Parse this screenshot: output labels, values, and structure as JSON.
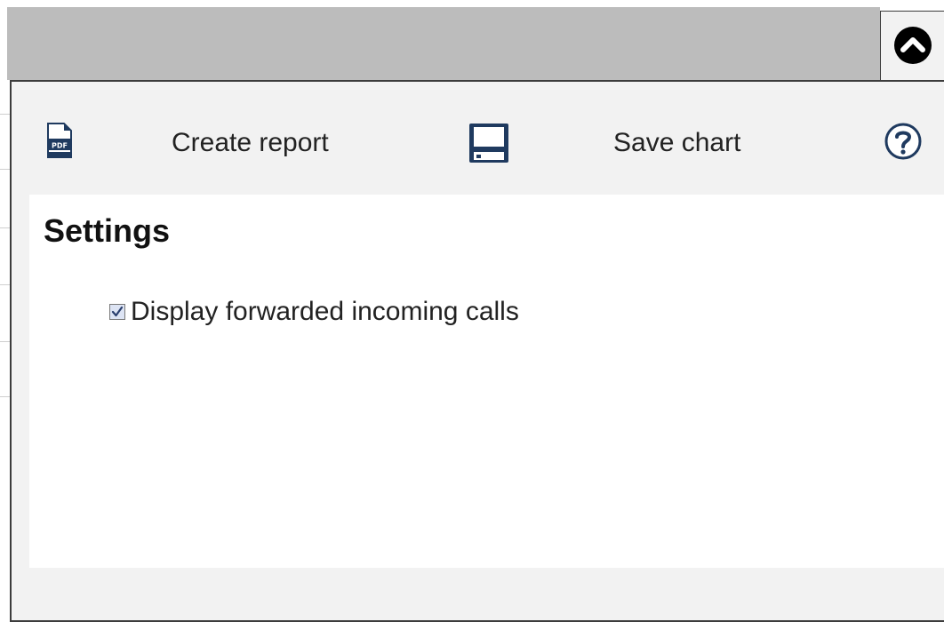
{
  "toolbar": {
    "create_report_label": "Create report",
    "save_chart_label": "Save chart",
    "pdf_icon_text": "PDF"
  },
  "settings": {
    "title": "Settings",
    "options": [
      {
        "label": "Display forwarded incoming calls",
        "checked": true
      }
    ]
  },
  "icons": {
    "collapse": "chevron-up-circle-icon",
    "pdf": "pdf-file-icon",
    "save": "floppy-disk-icon",
    "help": "question-circle-icon"
  },
  "colors": {
    "top_bar": "#bcbcbc",
    "panel_bg": "#f2f2f2",
    "icon_navy": "#1f3a5f",
    "border": "#3c3c3c"
  }
}
